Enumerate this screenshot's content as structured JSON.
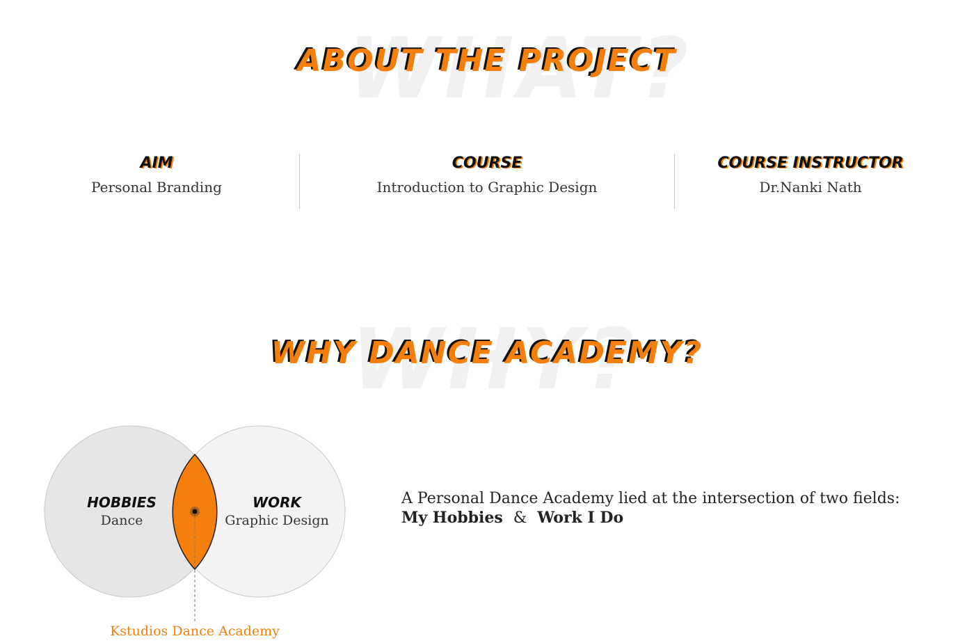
{
  "section1": {
    "watermark": "WHAT?",
    "title": "ABOUT THE PROJECT",
    "items": [
      {
        "heading": "AIM",
        "value": "Personal Branding"
      },
      {
        "heading": "COURSE",
        "value": "Introduction to Graphic Design"
      },
      {
        "heading": "COURSE INSTRUCTOR",
        "value": "Dr.Nanki Nath"
      }
    ]
  },
  "section2": {
    "watermark": "WHY?",
    "title": "WHY DANCE ACADEMY?",
    "venn": {
      "left": {
        "heading": "HOBBIES",
        "value": "Dance"
      },
      "right": {
        "heading": "WORK",
        "value": "Graphic Design"
      },
      "intersection": "Kstudios Dance Academy"
    },
    "description": {
      "line1": "A Personal Dance Academy lied at the intersection of two fields:",
      "part1": "My Hobbies",
      "amp": "&",
      "part2": "Work I Do"
    },
    "colors": {
      "accent": "#f57f0c"
    }
  }
}
